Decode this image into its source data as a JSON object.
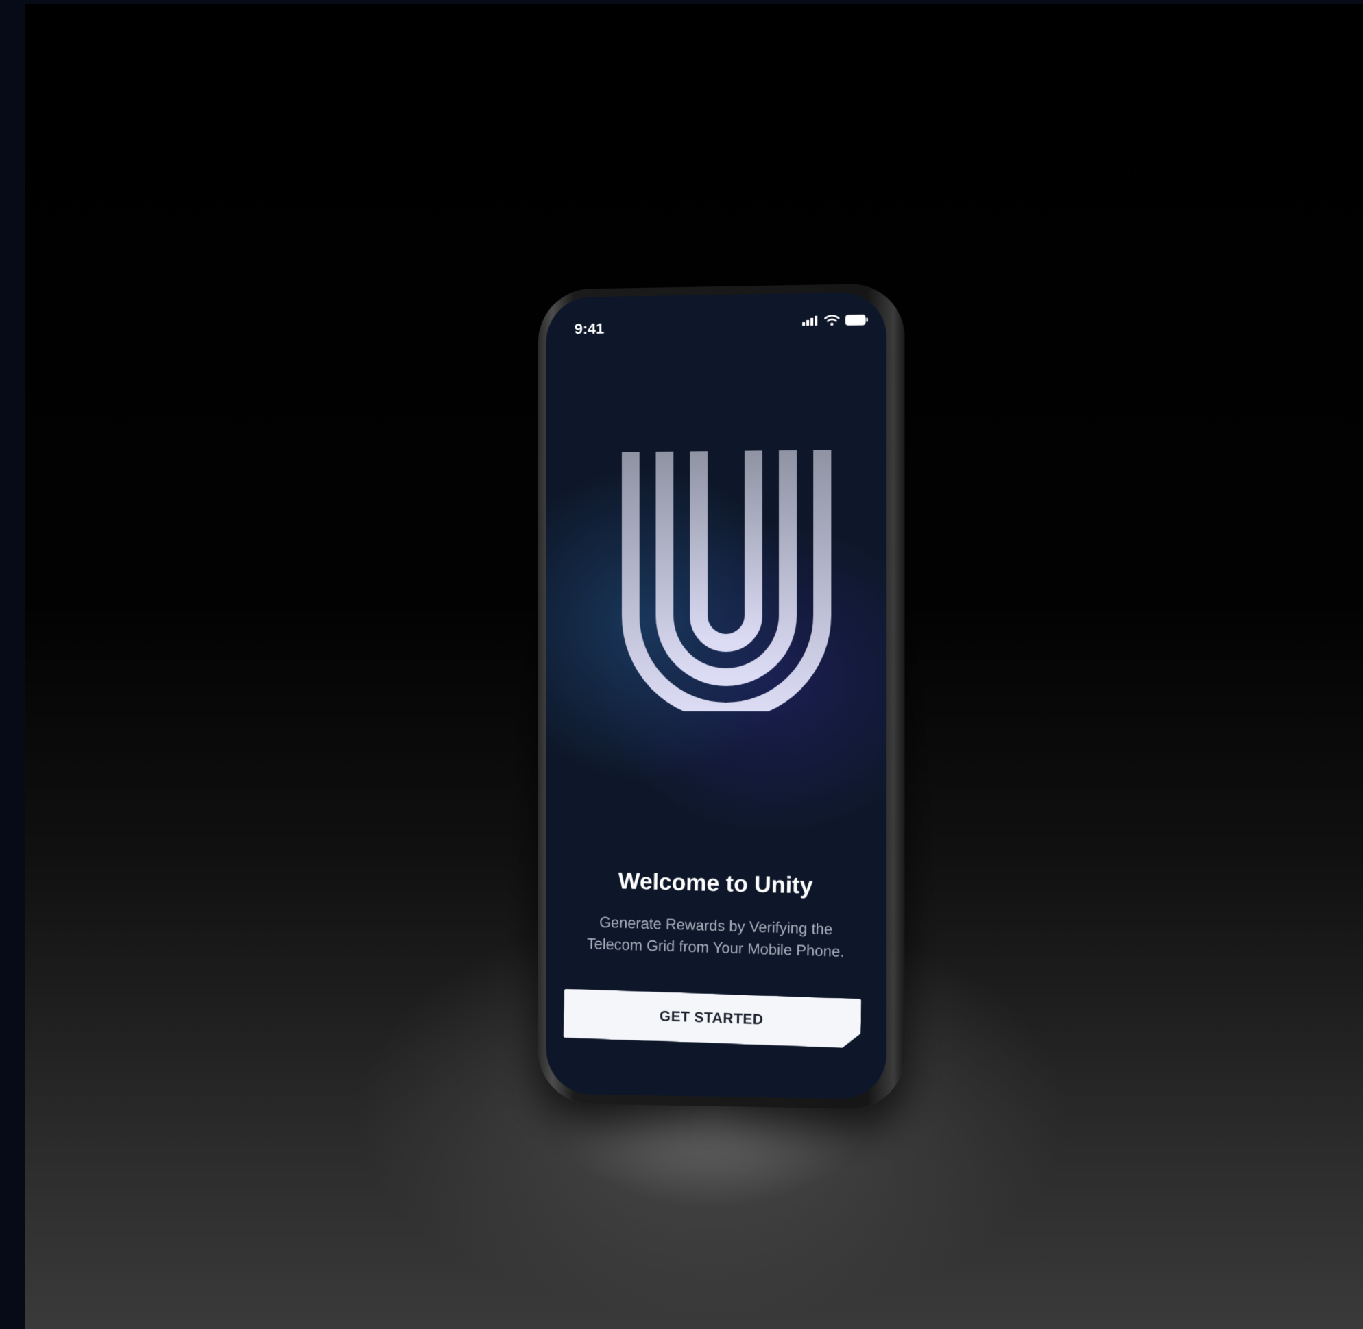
{
  "status_bar": {
    "time": "9:41",
    "icons": [
      "signal-icon",
      "wifi-icon",
      "battery-icon"
    ]
  },
  "logo": {
    "name": "unity-logo",
    "colors": [
      "#8f93a3",
      "#dcdcf5"
    ]
  },
  "welcome": {
    "title": "Welcome to Unity",
    "subtitle_line1": "Generate Rewards by Verifying the",
    "subtitle_line2": "Telecom Grid from Your Mobile Phone."
  },
  "cta": {
    "label": "GET STARTED"
  },
  "colors": {
    "screen_background": "#0e1729",
    "button_background": "#f4f6fa",
    "button_text": "#1a1f2c",
    "subtitle_text": "#a9afbd"
  }
}
